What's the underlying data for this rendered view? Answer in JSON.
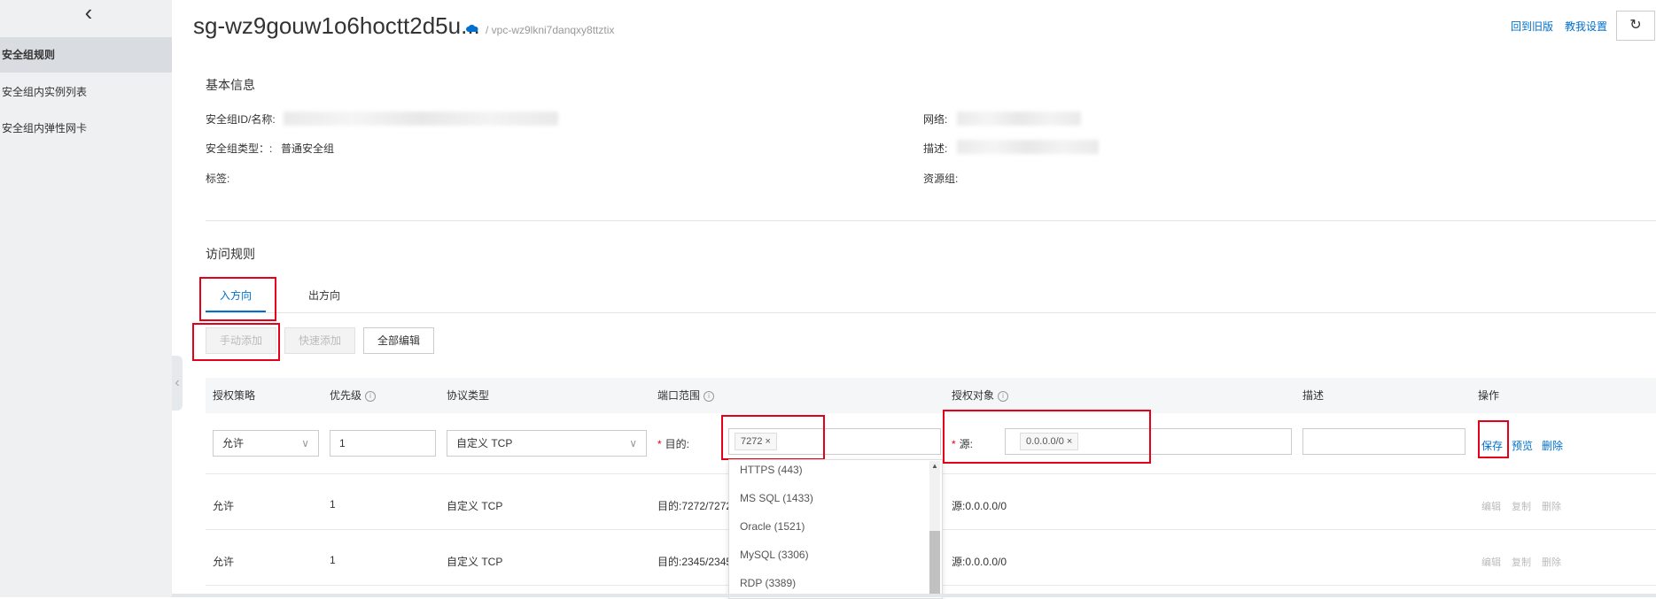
{
  "sidebar": {
    "items": [
      {
        "label": "安全组规则",
        "active": true
      },
      {
        "label": "安全组内实例列表",
        "active": false
      },
      {
        "label": "安全组内弹性网卡",
        "active": false
      }
    ]
  },
  "header": {
    "title": "sg-wz9gouw1o6hoctt2d5u...",
    "vpc": "/ vpc-wz9lkni7danqxy8ttztix",
    "back_to_old": "回到旧版",
    "help_settings": "教我设置"
  },
  "basic_info": {
    "section_title": "基本信息",
    "sg_id_label": "安全组ID/名称:",
    "sg_type_label": "安全组类型：:",
    "sg_type_value": "普通安全组",
    "tags_label": "标签:",
    "network_label": "网络:",
    "desc_label": "描述:",
    "resource_group_label": "资源组:"
  },
  "access_rules": {
    "section_title": "访问规则",
    "tabs": [
      {
        "label": "入方向",
        "active": true
      },
      {
        "label": "出方向",
        "active": false
      }
    ],
    "buttons": {
      "manual_add": "手动添加",
      "quick_add": "快速添加",
      "edit_all": "全部编辑"
    },
    "columns": [
      "授权策略",
      "优先级",
      "协议类型",
      "端口范围",
      "授权对象",
      "描述",
      "操作"
    ],
    "edit_row": {
      "policy": "允许",
      "priority": "1",
      "protocol": "自定义 TCP",
      "dest_label": "目的:",
      "dest_tag": "7272",
      "source_label": "源:",
      "source_tag": "0.0.0.0/0",
      "description": "",
      "actions": [
        "保存",
        "预览",
        "删除"
      ]
    },
    "rows": [
      {
        "policy": "允许",
        "priority": "1",
        "protocol": "自定义 TCP",
        "port": "目的:7272/7272",
        "source": "源:0.0.0.0/0",
        "actions": [
          "编辑",
          "复制",
          "删除"
        ]
      },
      {
        "policy": "允许",
        "priority": "1",
        "protocol": "自定义 TCP",
        "port": "目的:2345/2345",
        "source": "源:0.0.0.0/0",
        "actions": [
          "编辑",
          "复制",
          "删除"
        ]
      }
    ],
    "port_dropdown": [
      "HTTPS (443)",
      "MS SQL (1433)",
      "Oracle (1521)",
      "MySQL (3306)",
      "RDP (3389)"
    ]
  },
  "icons": {
    "back": "chevron-left-icon",
    "refresh": "refresh-icon",
    "cloud": "cloud-icon",
    "info": "info-icon",
    "close": "close-icon",
    "dropdown": "chevron-down-icon"
  },
  "colors": {
    "link": "#0070cc",
    "highlight": "#e5001a",
    "sidebar_bg": "#eef0f2"
  }
}
